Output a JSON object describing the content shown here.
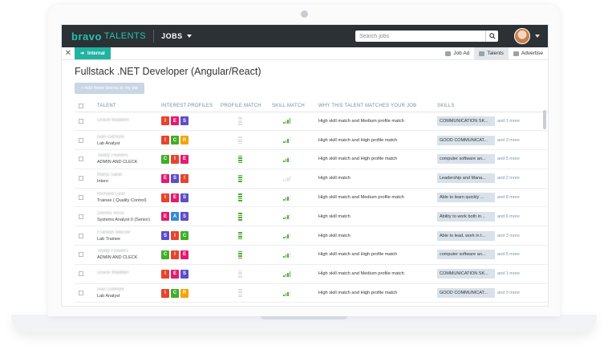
{
  "app": {
    "logo": "bravo",
    "logo_sub": "TALENTS",
    "nav_jobs": "JOBS"
  },
  "search": {
    "placeholder": "Search jobs"
  },
  "subbar": {
    "close": "✕",
    "internal": "Internal",
    "tabs": [
      {
        "label": "Job Ad",
        "icon": "job-ad-icon"
      },
      {
        "label": "Talents",
        "icon": "talents-icon",
        "active": true
      },
      {
        "label": "Advertise",
        "icon": "megaphone-icon"
      }
    ]
  },
  "page": {
    "title": "Fullstack .NET Developer (Angular/React)",
    "add_button": "+ Add these talents to my job"
  },
  "table": {
    "headers": [
      "",
      "TALENT",
      "INTEREST PROFILES",
      "PROFILE MATCH",
      "SKILL MATCH",
      "WHY THIS TALENT MATCHES YOUR JOB",
      "SKILLS"
    ],
    "rows": [
      {
        "name": "Grace Madden",
        "role": "",
        "profiles": [
          "I",
          "E",
          "S"
        ],
        "profile_match": 0,
        "skill_match": 4,
        "why": "High skill match and Medium profile match",
        "skill": "COMMUNICATION SK...",
        "more": "and 1 more"
      },
      {
        "name": "Ivan Gilmore",
        "role": "Lab Analyst",
        "profiles": [
          "I",
          "C",
          "R"
        ],
        "profile_match": 0,
        "skill_match": 3,
        "why": "High skill match and High profile match",
        "skill": "GOOD COMMUNICAT...",
        "more": "and 3 more"
      },
      {
        "name": "Teddy Flowers",
        "role": "ADMIN AND CLECK",
        "profiles": [
          "C",
          "I",
          "E"
        ],
        "profile_match": 4,
        "skill_match": 3,
        "why": "High skill match and High profile match",
        "skill": "computer software an...",
        "more": "and 5 more"
      },
      {
        "name": "Maria Salas",
        "role": "Intern",
        "profiles": [
          "E",
          "S",
          "I"
        ],
        "profile_match": 4,
        "skill_match": 0,
        "why": "High skill match",
        "skill": "Leadership and Mana...",
        "more": "and 2 more"
      },
      {
        "name": "Richard Lyon",
        "role": "Trainee ( Quality Control)",
        "profiles": [
          "I",
          "E",
          "S"
        ],
        "profile_match": 4,
        "skill_match": 3,
        "why": "High skill match and Medium profile match",
        "skill": "Able to learn quickly ...",
        "more": "and 8 more"
      },
      {
        "name": "Dennis Ross",
        "role": "Systems Analyst II (Senior)",
        "profiles": [
          "E",
          "A",
          "S"
        ],
        "profile_match": 4,
        "skill_match": 3,
        "why": "High skill match",
        "skill": "Ability to work both in...",
        "more": "and 6 more"
      },
      {
        "name": "Franklin Mercer",
        "role": "Lab Trainee",
        "profiles": [
          "S",
          "I",
          "C"
        ],
        "profile_match": 4,
        "skill_match": 3,
        "why": "High skill match",
        "skill": "Able to lead, work in t...",
        "more": "and 3 more"
      },
      {
        "name": "Teddy Flowers",
        "role": "ADMIN AND CLECK",
        "profiles": [
          "C",
          "I",
          "E"
        ],
        "profile_match": 4,
        "skill_match": 3,
        "why": "High skill match and High profile match",
        "skill": "computer software an...",
        "more": "and 5 more"
      },
      {
        "name": "Grace Madden",
        "role": "",
        "profiles": [
          "I",
          "E",
          "S"
        ],
        "profile_match": 0,
        "skill_match": 4,
        "why": "High skill match and Medium profile match",
        "skill": "COMMUNICATION SK...",
        "more": "and 1 more"
      },
      {
        "name": "Ivan Gilmore",
        "role": "Lab Analyst",
        "profiles": [
          "I",
          "C",
          "R"
        ],
        "profile_match": 0,
        "skill_match": 3,
        "why": "High skill match and High profile match",
        "skill": "GOOD COMMUNICAT...",
        "more": "and 3 more"
      }
    ]
  },
  "colors": {
    "brand": "#21c3ad",
    "topbar": "#2c3136",
    "match_green": "#4caf2e",
    "I": "#e8442d",
    "E": "#e5196e",
    "S": "#5c4ec9",
    "C": "#3fae2a",
    "R": "#f5a300",
    "A": "#2f8ed8"
  }
}
